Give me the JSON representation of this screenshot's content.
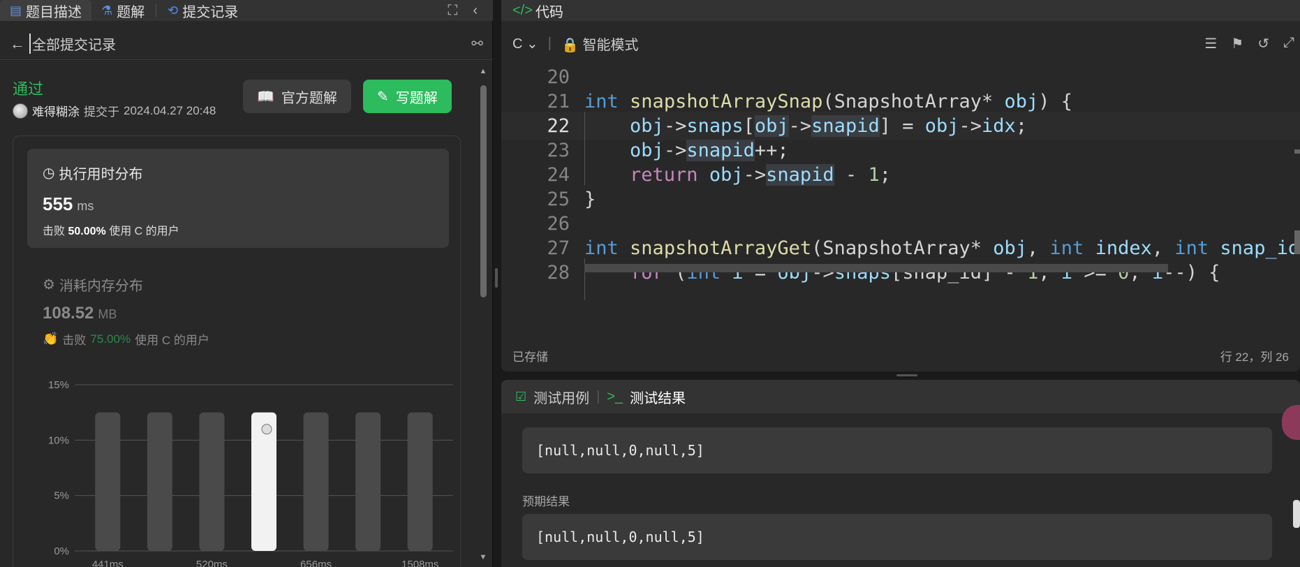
{
  "left_tabs": {
    "description": "题目描述",
    "solutions": "题解",
    "submissions": "提交记录"
  },
  "subbar": {
    "title": "全部提交记录"
  },
  "submission": {
    "status": "通过",
    "user": "难得糊涂",
    "submitted_prefix": "提交于",
    "submitted_at": "2024.04.27 20:48"
  },
  "buttons": {
    "official": "官方题解",
    "write": "写题解"
  },
  "runtime": {
    "title": "执行用时分布",
    "value": "555",
    "unit": "ms",
    "beat_prefix": "击败",
    "beat_pct": "50.00%",
    "beat_suffix": "使用 C 的用户"
  },
  "memory": {
    "title": "消耗内存分布",
    "value": "108.52",
    "unit": "MB",
    "beat_prefix": "击败",
    "beat_pct": "75.00%",
    "beat_suffix": "使用 C 的用户"
  },
  "chart_data": {
    "type": "bar",
    "y_ticks": [
      "15%",
      "10%",
      "5%",
      "0%"
    ],
    "ylim": [
      0,
      15
    ],
    "categories": [
      "441ms",
      "",
      "520ms",
      "",
      "656ms",
      "",
      "1508ms"
    ],
    "x_tick_labels": [
      "441ms",
      "520ms",
      "656ms",
      "1508ms"
    ],
    "values": [
      12.5,
      12.5,
      12.5,
      12.5,
      12.5,
      12.5,
      12.5
    ],
    "highlight_index": 3,
    "colors": {
      "bar": "#4a4a4a",
      "highlight": "#f2f2f2",
      "grid": "#555555"
    }
  },
  "code": {
    "tab_label": "代码",
    "language": "C",
    "mode": "智能模式",
    "saved": "已存储",
    "cursor_pos": "行 22，列 26",
    "current_line": 22
  },
  "test": {
    "tab_cases": "测试用例",
    "tab_result": "测试结果",
    "output": "[null,null,0,null,5]",
    "expected_label": "预期结果",
    "expected": "[null,null,0,null,5]"
  }
}
